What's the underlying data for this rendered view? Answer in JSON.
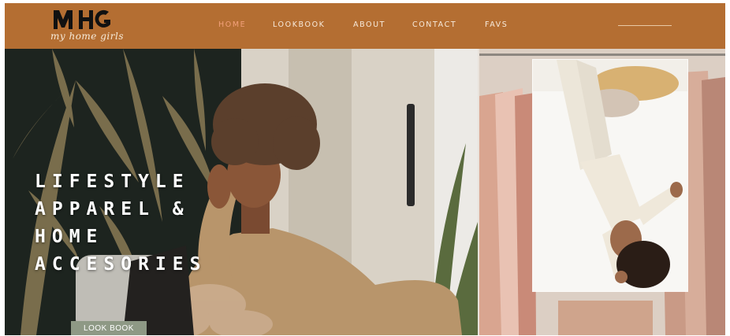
{
  "brand": {
    "logo_text": "MHG",
    "tagline": "my home girls"
  },
  "nav": {
    "items": [
      {
        "label": "HOME",
        "active": true
      },
      {
        "label": "LOOKBOOK",
        "active": false
      },
      {
        "label": "ABOUT",
        "active": false
      },
      {
        "label": "CONTACT",
        "active": false
      },
      {
        "label": "FAVS",
        "active": false
      }
    ]
  },
  "hero": {
    "headline_lines": [
      "LIFESTYLE",
      "APPAREL &",
      "HOME",
      "ACCESORIES"
    ],
    "cta_label": "LOOK BOOK"
  },
  "colors": {
    "header_bg": "#b46e32",
    "nav_active": "#f2a07a",
    "nav_text": "#f7eadb",
    "cta_bg": "#8e9985"
  }
}
